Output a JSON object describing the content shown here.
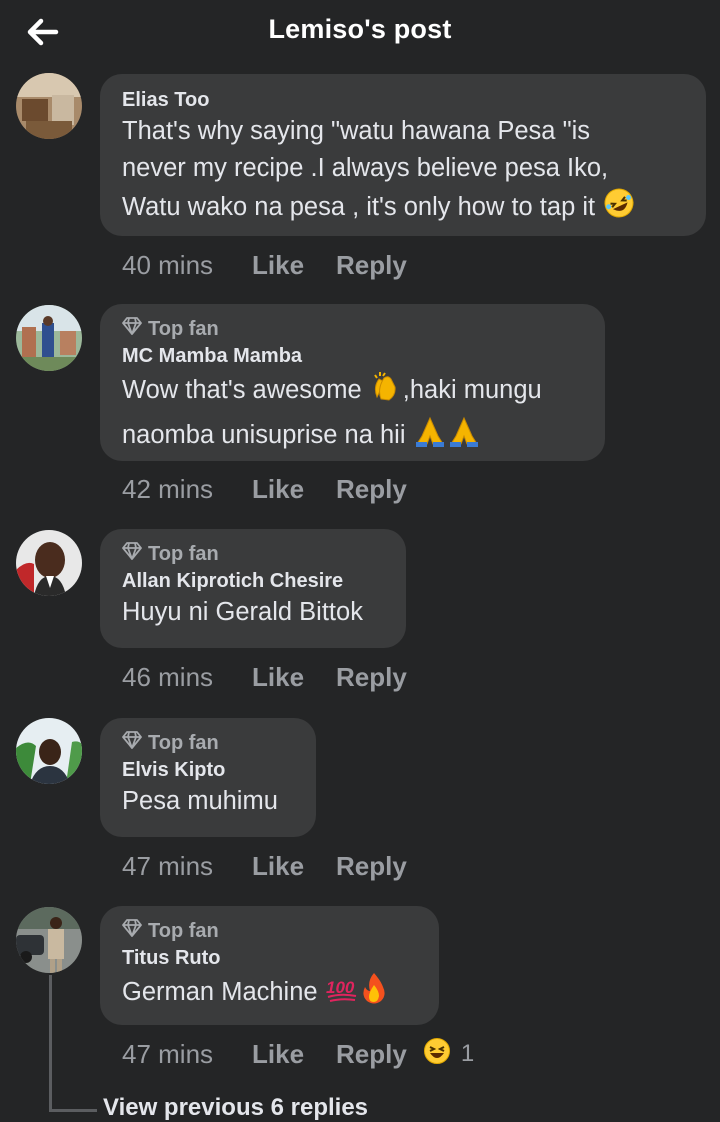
{
  "header": {
    "title": "Lemiso's post"
  },
  "comments": [
    {
      "author": "Elias Too",
      "top_fan_label": "",
      "lines": [
        "That's why saying \"watu hawana Pesa \"is",
        "never my recipe .I always believe pesa Iko,",
        "Watu wako na pesa , it's only how to tap it"
      ],
      "time": "40 mins",
      "like": "Like",
      "reply": "Reply"
    },
    {
      "author": "MC Mamba Mamba",
      "top_fan_label": "Top fan",
      "lines": [
        "Wow that's awesome",
        ",haki mungu",
        "naomba unisuprise na hii"
      ],
      "time": "42 mins",
      "like": "Like",
      "reply": "Reply"
    },
    {
      "author": "Allan Kiprotich Chesire",
      "top_fan_label": "Top fan",
      "lines": [
        "Huyu ni Gerald Bittok"
      ],
      "time": "46 mins",
      "like": "Like",
      "reply": "Reply"
    },
    {
      "author": "Elvis Kipto",
      "top_fan_label": "Top fan",
      "lines": [
        "Pesa muhimu"
      ],
      "time": "47 mins",
      "like": "Like",
      "reply": "Reply"
    },
    {
      "author": "Titus Ruto",
      "top_fan_label": "Top fan",
      "lines": [
        "German Machine"
      ],
      "time": "47 mins",
      "like": "Like",
      "reply": "Reply",
      "reaction_count": "1"
    }
  ],
  "view_previous": "View previous 6 replies",
  "icons": {
    "back": "arrow-left-icon",
    "top_fan": "diamond-icon",
    "laugh": "rolling-laughing-emoji",
    "clap": "clapping-hands-emoji",
    "pray": "folded-hands-emoji",
    "hundred": "hundred-points-emoji",
    "fire": "fire-emoji",
    "reaction": "laughing-emoji"
  },
  "colors": {
    "background": "#242526",
    "bubble": "#3a3b3c",
    "text": "#e4e6eb",
    "muted": "#9a9da2"
  }
}
